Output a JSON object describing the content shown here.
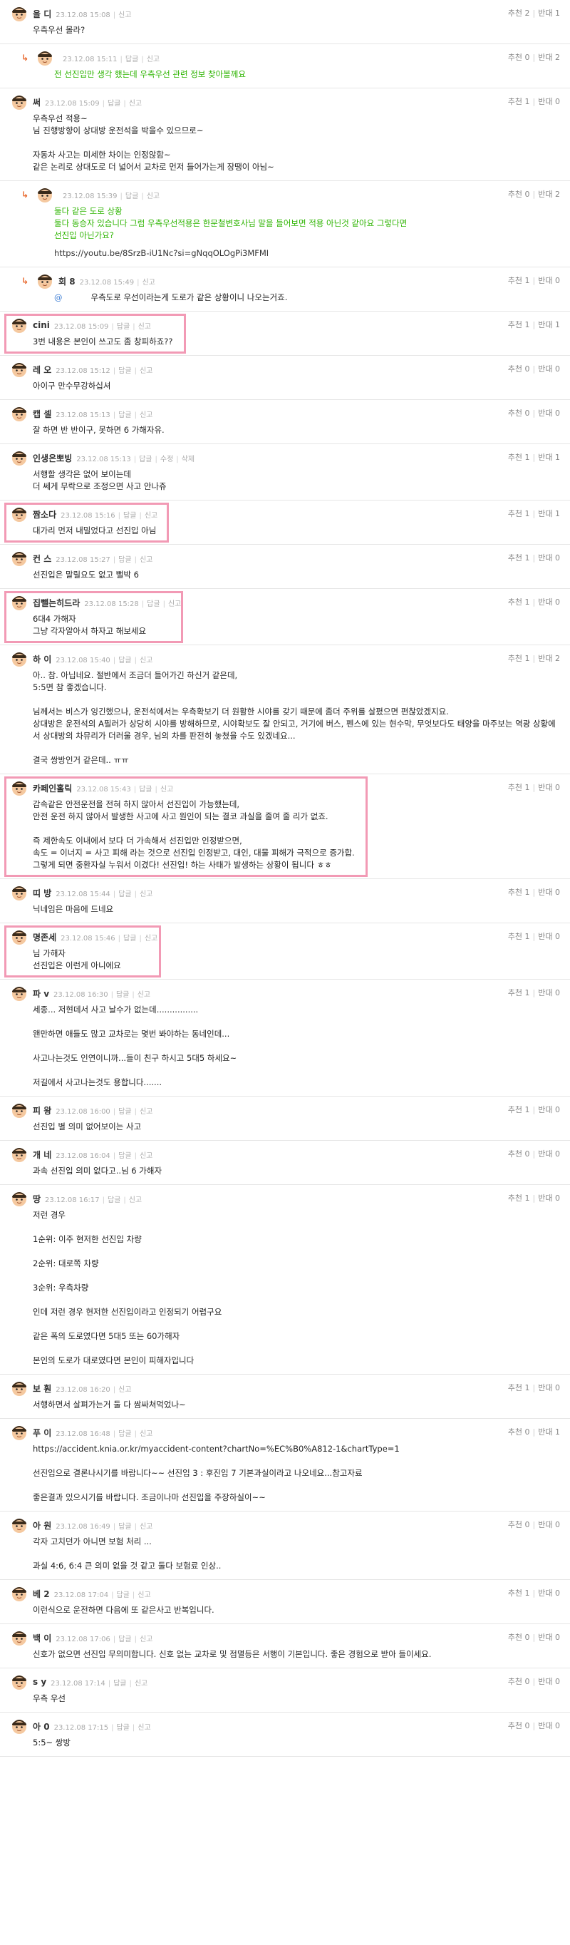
{
  "labels": {
    "reply": "답글",
    "report": "신고",
    "edit": "수정",
    "delete": "삭제",
    "up": "추천",
    "down": "반대"
  },
  "comments": [
    {
      "nick": "을  디",
      "date": "23.12.08 15:08",
      "actions": [
        "신고"
      ],
      "up": "2",
      "down": "1",
      "text": "우측우선 몰라?",
      "reply": false,
      "green": false
    },
    {
      "nick": "",
      "date": "23.12.08 15:11",
      "actions": [
        "답글",
        "신고"
      ],
      "up": "0",
      "down": "2",
      "text": "전 선진입만 생각 했는데 우측우선 관련 정보 찾아볼께요",
      "reply": true,
      "green": true
    },
    {
      "nick": "써",
      "date": "23.12.08 15:09",
      "actions": [
        "답글",
        "신고"
      ],
      "up": "1",
      "down": "0",
      "text": "우측우선 적용~\n님 진행방향이 상대방 운전석을 박을수 있으므로~\n\n자동차 사고는 미세한 차이는 인정않함~\n같은 논리로 상대도로 더 넓어서 교차로 먼저 들어가는게 장땡이 아님~",
      "reply": false,
      "green": false
    },
    {
      "nick": "",
      "date": "23.12.08 15:39",
      "actions": [
        "답글",
        "신고"
      ],
      "up": "0",
      "down": "2",
      "text": "둘다 같은 도로 상황\n둘다 동승자 있습니다 그럼 우측우선적용은 한문철변호사님 말을 들어보면 적용 아닌것 같아요 그렇다면\n선진입 아닌가요?",
      "link": "https://youtu.be/8SrzB-iU1Nc?si=gNqqOLOgPi3MFMI",
      "reply": true,
      "green": true
    },
    {
      "nick": "회      8",
      "date": "23.12.08 15:49",
      "actions": [
        "신고"
      ],
      "up": "1",
      "down": "0",
      "mention": "@",
      "text": "우측도로 우선이라는게 도로가 같은 상황이니 나오는거죠.",
      "reply": true,
      "green": false
    },
    {
      "nick": "cini",
      "date": "23.12.08 15:09",
      "actions": [
        "답글",
        "신고"
      ],
      "up": "1",
      "down": "1",
      "text": "3번 내용은 본인이 쓰고도 좀 창피하죠??",
      "reply": false,
      "green": false,
      "hl": true
    },
    {
      "nick": "레              오",
      "date": "23.12.08 15:12",
      "actions": [
        "답글",
        "신고"
      ],
      "up": "0",
      "down": "0",
      "text": "아이구 만수무강하십셔",
      "reply": false,
      "green": false
    },
    {
      "nick": "캡      셀",
      "date": "23.12.08 15:13",
      "actions": [
        "답글",
        "신고"
      ],
      "up": "0",
      "down": "0",
      "text": "잘 하면 반 반이구, 못하면 6 가해자유.",
      "reply": false,
      "green": false
    },
    {
      "nick": "인생은뽀빙",
      "date": "23.12.08 15:13",
      "actions": [
        "답글",
        "수정",
        "삭제"
      ],
      "up": "1",
      "down": "1",
      "text": "서행할 생각은 없어 보이는데\n더 쎄게 무락으로 조정으면 사고 안나쥬",
      "reply": false,
      "green": false
    },
    {
      "nick": "짬소다",
      "date": "23.12.08 15:16",
      "actions": [
        "답글",
        "신고"
      ],
      "up": "1",
      "down": "1",
      "text": "대가리 먼저 내밀었다고 선진입 아님",
      "reply": false,
      "green": false,
      "hl": true
    },
    {
      "nick": "컨      스",
      "date": "23.12.08 15:27",
      "actions": [
        "답글",
        "신고"
      ],
      "up": "1",
      "down": "0",
      "text": "선진입은 말릴요도 없고 뻘박 6",
      "reply": false,
      "green": false
    },
    {
      "nick": "집뺄는히드라",
      "date": "23.12.08 15:28",
      "actions": [
        "답글",
        "신고"
      ],
      "up": "1",
      "down": "0",
      "text": "6대4 가해자\n그냥 각자알아서 하자고 해보세요",
      "reply": false,
      "green": false,
      "hl": true
    },
    {
      "nick": "하      이",
      "date": "23.12.08 15:40",
      "actions": [
        "답글",
        "신고"
      ],
      "up": "1",
      "down": "2",
      "text": "아.. 참. 아닙네요. 절반에서 조금더 들어가긴 하신거 같은데,\n5:5면 참 좋겠습니다.\n\n님께서는 비스가 잉긴했으나, 운전석에서는 우측확보기 더 원활한 시야를 갖기 때문에 좀더 주위를 살폈으면 편찮았겠지요.\n상대방은 운전석의 A필러가 상당히 시야를 방해하므로, 시야확보도 잘 안되고, 거기에 버스, 펜스에 있는 현수막, 무엇보다도 태양을 마주보는 역광 상황에서 상대방의 차뮤리가 더러울 경우, 님의 차를 판전히 놓쳤을 수도 있겠네요...\n\n결국 쌍방인거 같은데.. ㅠㅠ",
      "reply": false,
      "green": false
    },
    {
      "nick": "카페인홀릭",
      "date": "23.12.08 15:43",
      "actions": [
        "답글",
        "신고"
      ],
      "up": "1",
      "down": "0",
      "text": "감속같은 안전운전을 전혀 하지 않아서 선진입이 가능했는데,\n안전 운전 하지 않아서 발생한 사고에 사고 원인이 되는 결코 과실을 줄여 줄 리가 없죠.\n\n즉 제한속도 이내에서 보다 더 가속해서 선진입만 인정받으면,\n속도 = 이너지 = 사고 피해 라는 것으로 선진입 인정받고, 대인, 대물 피해가 극적으로 증가합.\n그렇게 되면 중환자실 누워서 이겼다! 선진입! 하는 사태가 발생하는 상황이 됩니다 ㅎㅎ",
      "reply": false,
      "green": false,
      "hl": true
    },
    {
      "nick": "띠      방",
      "date": "23.12.08 15:44",
      "actions": [
        "답글",
        "신고"
      ],
      "up": "1",
      "down": "0",
      "text": "닉네임은 마음에 드네요",
      "reply": false,
      "green": false
    },
    {
      "nick": "명존세",
      "date": "23.12.08 15:46",
      "actions": [
        "답글",
        "신고"
      ],
      "up": "1",
      "down": "0",
      "text": "님 가해자\n선진입은 이런게 아니에요",
      "reply": false,
      "green": false,
      "hl": true
    },
    {
      "nick": "파              v",
      "date": "23.12.08 16:30",
      "actions": [
        "답글",
        "신고"
      ],
      "up": "1",
      "down": "0",
      "text": "세종... 저현데서 사고 날수가 없는데................\n\n왠만하면 애들도 많고 교차로는 몇번 봐야하는 동네인데...\n\n사고나는것도 인연이니까...들이 친구 하시고 5대5 하세요~\n\n저길에서 사고나는것도 용합니다.......",
      "reply": false,
      "green": false
    },
    {
      "nick": "피          왕",
      "date": "23.12.08 16:00",
      "actions": [
        "답글",
        "신고"
      ],
      "up": "1",
      "down": "0",
      "text": "선진입 별 의미 없어보이는 사고",
      "reply": false,
      "green": false
    },
    {
      "nick": "개                  네",
      "date": "23.12.08 16:04",
      "actions": [
        "답글",
        "신고"
      ],
      "up": "0",
      "down": "0",
      "text": "과속 선진입 의미 없다고..님 6 가해자",
      "reply": false,
      "green": false
    },
    {
      "nick": "땅",
      "date": "23.12.08 16:17",
      "actions": [
        "답글",
        "신고"
      ],
      "up": "1",
      "down": "0",
      "text": "저런 경우\n\n1순위: 이주 현저한 선진입 차량\n\n2순위: 대로쪽 차량\n\n3순위: 우측차량\n\n인데 저런 경우 현저한 선진입이라고 인정되기 어렵구요\n\n같은 폭의 도로였다면 5대5 또는 60가해자\n\n본인의 도로가 대로였다면 본인이 피해자입니다",
      "reply": false,
      "green": false
    },
    {
      "nick": "보      훤",
      "date": "23.12.08 16:20",
      "actions": [
        "신고"
      ],
      "up": "1",
      "down": "0",
      "text": "서행하면서 살펴가는거 둘 다 쌈싸쳐먹었나~",
      "reply": false,
      "green": false
    },
    {
      "nick": "푸          이",
      "date": "23.12.08 16:48",
      "actions": [
        "답글",
        "신고"
      ],
      "up": "0",
      "down": "1",
      "text": "https://accident.knia.or.kr/myaccident-content?chartNo=%EC%B0%A812-1&chartType=1\n\n선진입으로 결론나시기를 바랍니다~~ 선진입 3 : 후진입 7 기본과실이라고 나오네요...참고자료\n\n좋은결과 있으시기를 바랍니다. 조금이나마 선진입을 주장하실이~~",
      "reply": false,
      "green": false
    },
    {
      "nick": "아          원",
      "date": "23.12.08 16:49",
      "actions": [
        "답글",
        "신고"
      ],
      "up": "0",
      "down": "0",
      "text": "각자 고치던가 아니면 보험 처리 ...\n\n과실 4:6, 6:4 큰 의미 없을 것 같고 둘다 보험료 인상..",
      "reply": false,
      "green": false
    },
    {
      "nick": "베          2",
      "date": "23.12.08 17:04",
      "actions": [
        "답글",
        "신고"
      ],
      "up": "1",
      "down": "0",
      "text": "이런식으로 운전하면 다음에 또 같은사고 반복입니다.",
      "reply": false,
      "green": false
    },
    {
      "nick": "백      이",
      "date": "23.12.08 17:06",
      "actions": [
        "답글",
        "신고"
      ],
      "up": "0",
      "down": "0",
      "text": "신호가 없으면 선진입 무의미합니다. 신호 없는 교차로 및 점멸등은 서행이 기본입니다. 좋은 경험으로 받아 들이세요.",
      "reply": false,
      "green": false
    },
    {
      "nick": "s          y",
      "date": "23.12.08 17:14",
      "actions": [
        "답글",
        "신고"
      ],
      "up": "0",
      "down": "0",
      "text": "우측 우선",
      "reply": false,
      "green": false
    },
    {
      "nick": "아              0",
      "date": "23.12.08 17:15",
      "actions": [
        "답글",
        "신고"
      ],
      "up": "0",
      "down": "0",
      "text": "5:5~ 쌍방",
      "reply": false,
      "green": false
    }
  ]
}
